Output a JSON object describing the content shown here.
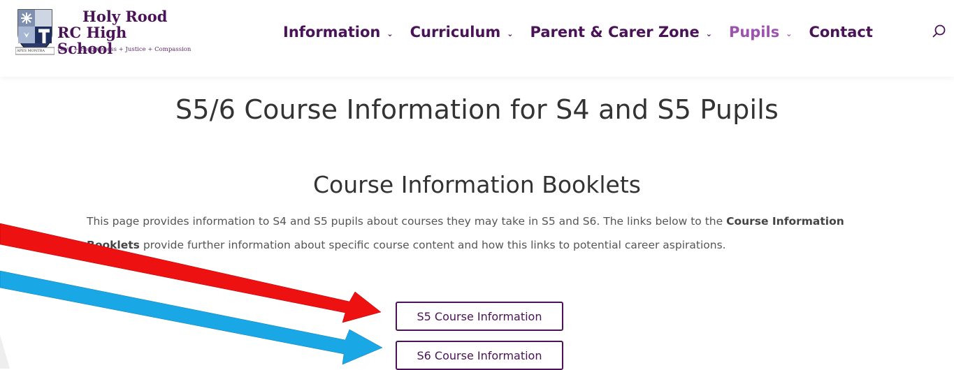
{
  "header": {
    "school_name_line1": "Holy Rood",
    "school_name_line2": "RC High School",
    "motto": "Love + Forgiveness + Justice + Compassion",
    "crest_banner": "APES MONTRA",
    "nav": [
      {
        "label": "Information",
        "has_dropdown": true
      },
      {
        "label": "Curriculum",
        "has_dropdown": true
      },
      {
        "label": "Parent & Carer Zone",
        "has_dropdown": true
      },
      {
        "label": "Pupils",
        "has_dropdown": true,
        "active": true
      },
      {
        "label": "Contact",
        "has_dropdown": false
      }
    ],
    "search_icon": "search-icon"
  },
  "main": {
    "page_title": "S5/6 Course Information for S4 and S5 Pupils",
    "section_title": "Course Information Booklets",
    "intro_part1": "This page provides information to S4 and S5 pupils about courses they may take in S5 and S6. The links below to the ",
    "intro_bold": "Course Information Booklets",
    "intro_part2": " provide further information about specific course content and how this links to potential career aspirations.",
    "buttons": [
      {
        "label": "S5 Course Information"
      },
      {
        "label": "S6 Course Information"
      }
    ]
  },
  "annotations": {
    "arrow_colors": [
      "#ee1111",
      "#1aa7e6"
    ]
  },
  "colors": {
    "brand_purple": "#4a1257",
    "active_nav": "#9e52b0"
  }
}
